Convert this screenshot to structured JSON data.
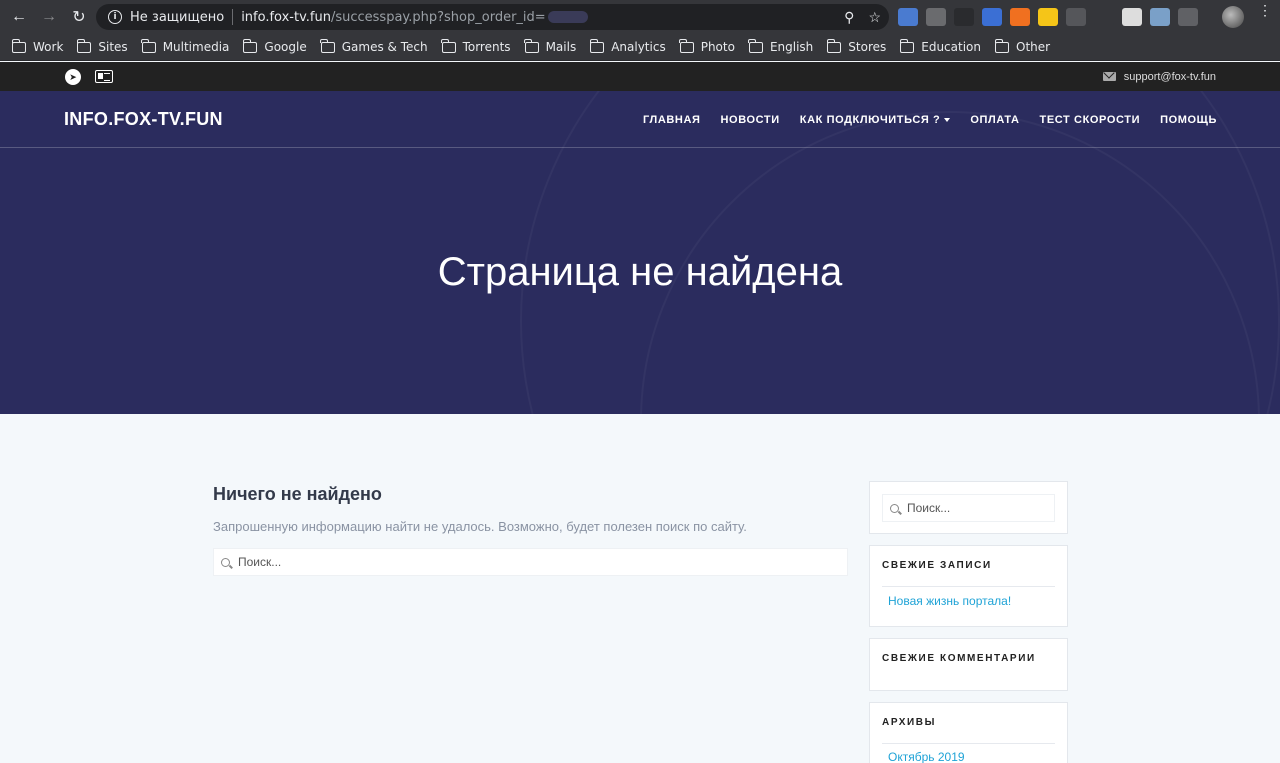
{
  "browser": {
    "security_label": "Не защищено",
    "url_host": "info.fox-tv.fun",
    "url_path": "/successpay.php?shop_order_id=",
    "bookmarks": [
      "Work",
      "Sites",
      "Multimedia",
      "Google",
      "Games & Tech",
      "Torrents",
      "Mails",
      "Analytics",
      "Photo",
      "English",
      "Stores",
      "Education",
      "Other"
    ]
  },
  "topbar": {
    "email": "support@fox-tv.fun"
  },
  "header": {
    "logo": "INFO.FOX-TV.FUN",
    "nav": [
      "ГЛАВНАЯ",
      "НОВОСТИ",
      "КАК ПОДКЛЮЧИТЬСЯ ?",
      "ОПЛАТА",
      "ТЕСТ СКОРОСТИ",
      "ПОМОЩЬ"
    ],
    "hero_title": "Страница не найдена"
  },
  "main": {
    "title": "Ничего не найдено",
    "text": "Запрошенную информацию найти не удалось. Возможно, будет полезен поиск по сайту.",
    "search_placeholder": "Поиск..."
  },
  "sidebar": {
    "search_placeholder": "Поиск...",
    "recent_posts_title": "СВЕЖИЕ ЗАПИСИ",
    "recent_posts": [
      "Новая жизнь портала!"
    ],
    "recent_comments_title": "СВЕЖИЕ КОММЕНТАРИИ",
    "archives_title": "АРХИВЫ",
    "archives": [
      "Октябрь 2019"
    ]
  },
  "colors": {
    "hero_bg": "#2b2c5e",
    "link": "#1fa3d6",
    "topbar_bg": "#222222"
  }
}
